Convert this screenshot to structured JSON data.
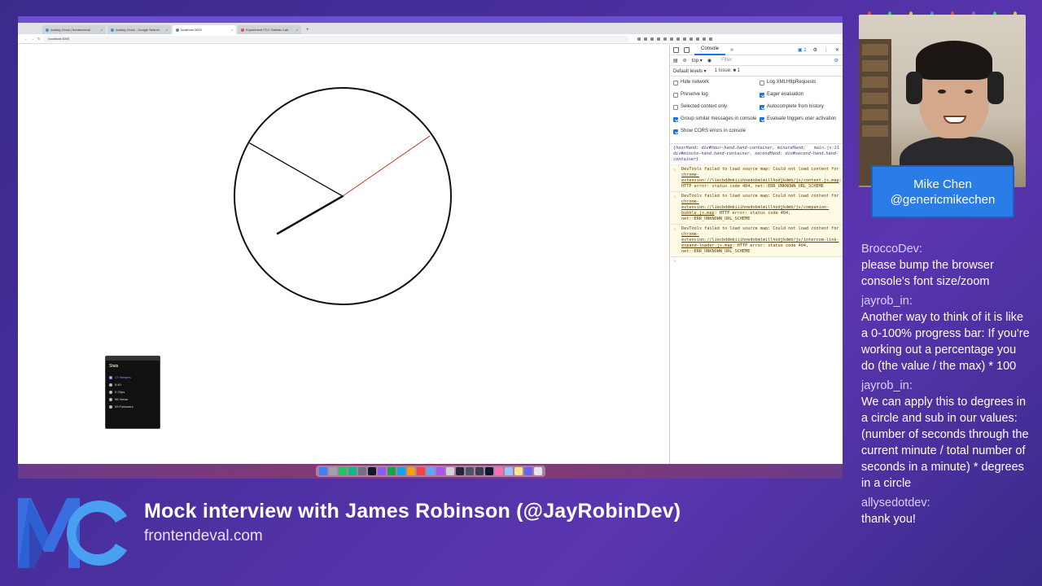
{
  "browser": {
    "tabs": [
      {
        "label": "Analog Clock | frontendeval",
        "active": false
      },
      {
        "label": "Analog Clock - Google Search",
        "active": false
      },
      {
        "label": "localhost:3000",
        "active": true
      },
      {
        "label": "Experiment FCC Tableau Lab",
        "active": false
      }
    ],
    "new_tab": "+",
    "address": "localhost:3000"
  },
  "clock": {
    "hour_hand_color": "#111111",
    "minute_hand_color": "#111111",
    "second_hand_color": "#c0392b"
  },
  "stats": {
    "title": "Stats",
    "rows": [
      {
        "label": "17 Viewers",
        "live": true
      },
      {
        "label": "0:40",
        "live": false
      },
      {
        "label": "0 Clips",
        "live": false
      },
      {
        "label": "96 Views",
        "live": false
      },
      {
        "label": "33 Followers",
        "live": false
      }
    ]
  },
  "devtools": {
    "tab": "Console",
    "more": "»",
    "issues_badge": "1",
    "context": "top ▾",
    "filter_placeholder": "Filter",
    "default_levels": "Default levels ▾",
    "issue_count": "1 Issue: ■ 1",
    "settings": [
      {
        "label": "Hide network",
        "checked": false
      },
      {
        "label": "Log XMLHttpRequests",
        "checked": false
      },
      {
        "label": "Preserve log",
        "checked": false
      },
      {
        "label": "Eager evaluation",
        "checked": true
      },
      {
        "label": "Selected context only",
        "checked": false
      },
      {
        "label": "Autocomplete from history",
        "checked": true
      },
      {
        "label": "Group similar messages in console",
        "checked": true
      },
      {
        "label": "Evaluate triggers user activation",
        "checked": true
      },
      {
        "label": "Show CORS errors in console",
        "checked": true
      },
      {
        "label": "",
        "checked": false
      }
    ],
    "log_source": "main.js:21",
    "log_text": "{hourHand: div#hour-hand.hand-container, minuteHand: div#minute-hand.hand-container, secondHand: div#second-hand.hand-container}",
    "warnings": [
      {
        "prefix": "DevTools failed to load source map: Could not load content for ",
        "link": "chrome-extension://liecbddmkiiihnedobmlmillhodjkdmb/js/content.js.map",
        "suffix": ": HTTP error: status code 404, net::ERR_UNKNOWN_URL_SCHEME"
      },
      {
        "prefix": "DevTools failed to load source map: Could not load content for ",
        "link": "chrome-extension://liecbddmkiiihnedobmlmillhodjkdmb/js/companion-bubble.js.map",
        "suffix": ": HTTP error: status code 404, net::ERR_UNKNOWN_URL_SCHEME"
      },
      {
        "prefix": "DevTools failed to load source map: Could not load content for ",
        "link": "chrome-extension://liecbddmkiiihnedobmlmillhodjkdmb/js/intercom-link-expand-loader.js.map",
        "suffix": ": HTTP error: status code 404, net::ERR_UNKNOWN_URL_SCHEME"
      }
    ],
    "prompt": "›"
  },
  "streamer": {
    "name": "Mike Chen",
    "handle": "@genericmikechen"
  },
  "chat": [
    {
      "user": "BroccoDev:",
      "message": "please bump the browser console's font size/zoom"
    },
    {
      "user": "jayrob_in:",
      "message": "Another way to think of it is like a 0-100% progress bar: If you're working out a percentage you do (the value / the max) * 100"
    },
    {
      "user": "jayrob_in:",
      "message": "We can apply this to degrees in a circle and sub in our values: (number of seconds through the current minute / total number of seconds in a minute) * degrees in a circle"
    },
    {
      "user": "allysedotdev:",
      "message": "thank you!"
    }
  ],
  "banner": {
    "title": "Mock interview with James Robinson (@JayRobinDev)",
    "site": "frontendeval.com"
  },
  "colors": {
    "background": "#4a2f9e",
    "name_card": "#2a7de6",
    "devtools_accent": "#1a73e8"
  }
}
